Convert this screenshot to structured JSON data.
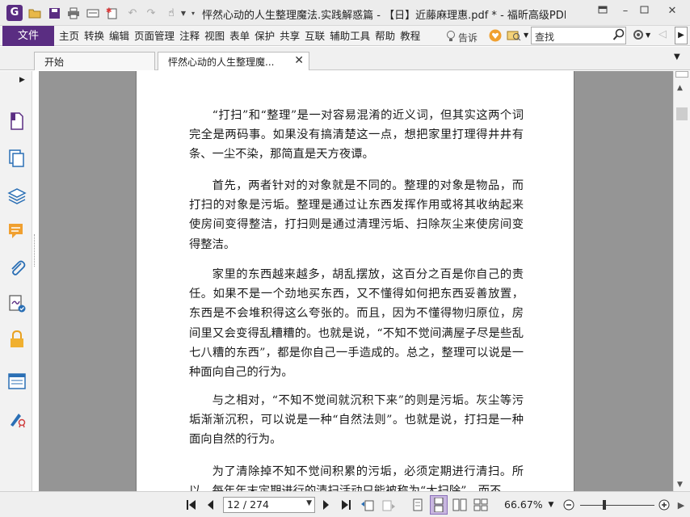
{
  "window": {
    "title": "怦然心动的人生整理魔法.实践解惑篇 - 【日】近藤麻理惠.pdf * - 福昕高级PDF编...",
    "app_icon_letter": "G"
  },
  "menu": {
    "file": "文件",
    "items": [
      "主页",
      "转换",
      "编辑",
      "页面管理",
      "注释",
      "视图",
      "表单",
      "保护",
      "共享",
      "互联",
      "辅助工具",
      "帮助",
      "教程"
    ],
    "tell_me": "告诉",
    "search_placeholder": "查找"
  },
  "tabs": [
    {
      "label": "开始"
    },
    {
      "label": "怦然心动的人生整理魔..."
    }
  ],
  "document": {
    "paragraphs": [
      "“打扫”和“整理”是一对容易混淆的近义词，但其实这两个词完全是两码事。如果没有搞清楚这一点，想把家里打理得井井有条、一尘不染，那简直是天方夜谭。",
      "首先，两者针对的对象就是不同的。整理的对象是物品，而打扫的对象是污垢。整理是通过让东西发挥作用或将其收纳起来使房间变得整洁，打扫则是通过清理污垢、扫除灰尘来使房间变得整洁。",
      "家里的东西越来越多，胡乱摆放，这百分之百是你自己的责任。如果不是一个劲地买东西，又不懂得如何把东西妥善放置，东西是不会堆积得这么夸张的。而且，因为不懂得物归原位，房间里又会变得乱糟糟的。也就是说，“不知不觉间满屋子尽是些乱七八糟的东西”，都是你自己一手造成的。总之，整理可以说是一种面向自己的行为。",
      "与之相对，“不知不觉间就沉积下来”的则是污垢。灰尘等污垢渐渐沉积，可以说是一种“自然法则”。也就是说，打扫是一种面向自然的行为。",
      "为了清除掉不知不觉间积累的污垢，必须定期进行清扫。所以，每年年末定期进行的清扫活动只能被称为“大扫除”，而不"
    ]
  },
  "status": {
    "page_display": "12 / 274",
    "zoom": "66.67%"
  },
  "colors": {
    "brand": "#5a2d82",
    "doc_background": "#959595"
  }
}
